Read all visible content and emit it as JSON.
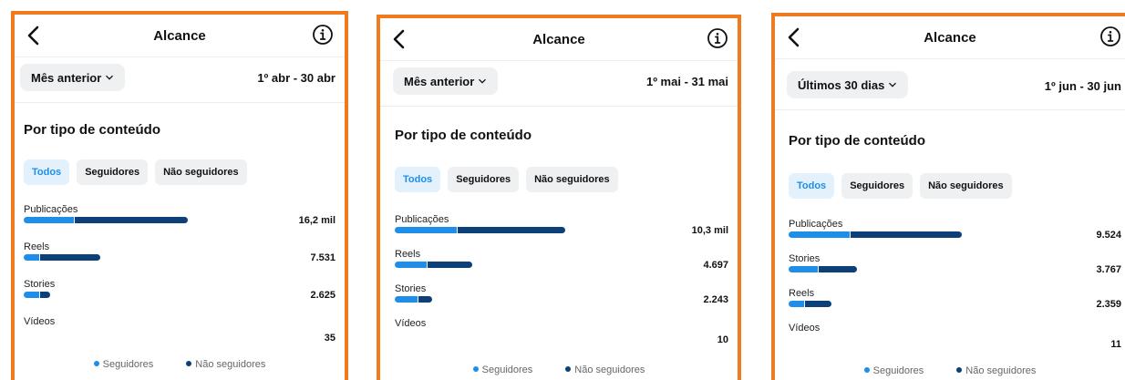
{
  "colors": {
    "followers": "#1e8ee8",
    "non_followers": "#0d3f78",
    "frame": "#f07a1e"
  },
  "panels": [
    {
      "title": "Alcance",
      "period_label": "Mês anterior",
      "date_range": "1º abr - 30 abr",
      "section_title": "Por tipo de conteúdo",
      "tabs": [
        "Todos",
        "Seguidores",
        "Não seguidores"
      ],
      "active_tab": 0,
      "rows": [
        {
          "label": "Publicações",
          "value": "16,2 mil",
          "total": 16200,
          "followers_share": 0.31
        },
        {
          "label": "Reels",
          "value": "7.531",
          "total": 7531,
          "followers_share": 0.22
        },
        {
          "label": "Stories",
          "value": "2.625",
          "total": 2625,
          "followers_share": 0.62
        },
        {
          "label": "Vídeos",
          "value": "35",
          "total": 35,
          "followers_share": 0.5
        }
      ],
      "legend": {
        "followers": "Seguidores",
        "non_followers": "Não seguidores"
      }
    },
    {
      "title": "Alcance",
      "period_label": "Mês anterior",
      "date_range": "1º mai - 31 mai",
      "section_title": "Por tipo de conteúdo",
      "tabs": [
        "Todos",
        "Seguidores",
        "Não seguidores"
      ],
      "active_tab": 0,
      "rows": [
        {
          "label": "Publicações",
          "value": "10,3 mil",
          "total": 10300,
          "followers_share": 0.37
        },
        {
          "label": "Reels",
          "value": "4.697",
          "total": 4697,
          "followers_share": 0.42
        },
        {
          "label": "Stories",
          "value": "2.243",
          "total": 2243,
          "followers_share": 0.63
        },
        {
          "label": "Vídeos",
          "value": "10",
          "total": 10,
          "followers_share": 0.5
        }
      ],
      "legend": {
        "followers": "Seguidores",
        "non_followers": "Não seguidores"
      }
    },
    {
      "title": "Alcance",
      "period_label": "Últimos 30 dias",
      "date_range": "1º jun - 30 jun",
      "section_title": "Por tipo de conteúdo",
      "tabs": [
        "Todos",
        "Seguidores",
        "Não seguidores"
      ],
      "active_tab": 0,
      "rows": [
        {
          "label": "Publicações",
          "value": "9.524",
          "total": 9524,
          "followers_share": 0.36
        },
        {
          "label": "Stories",
          "value": "3.767",
          "total": 3767,
          "followers_share": 0.44
        },
        {
          "label": "Reels",
          "value": "2.359",
          "total": 2359,
          "followers_share": 0.38
        },
        {
          "label": "Vídeos",
          "value": "11",
          "total": 11,
          "followers_share": 0.5
        }
      ],
      "legend": {
        "followers": "Seguidores",
        "non_followers": "Não seguidores"
      }
    }
  ]
}
